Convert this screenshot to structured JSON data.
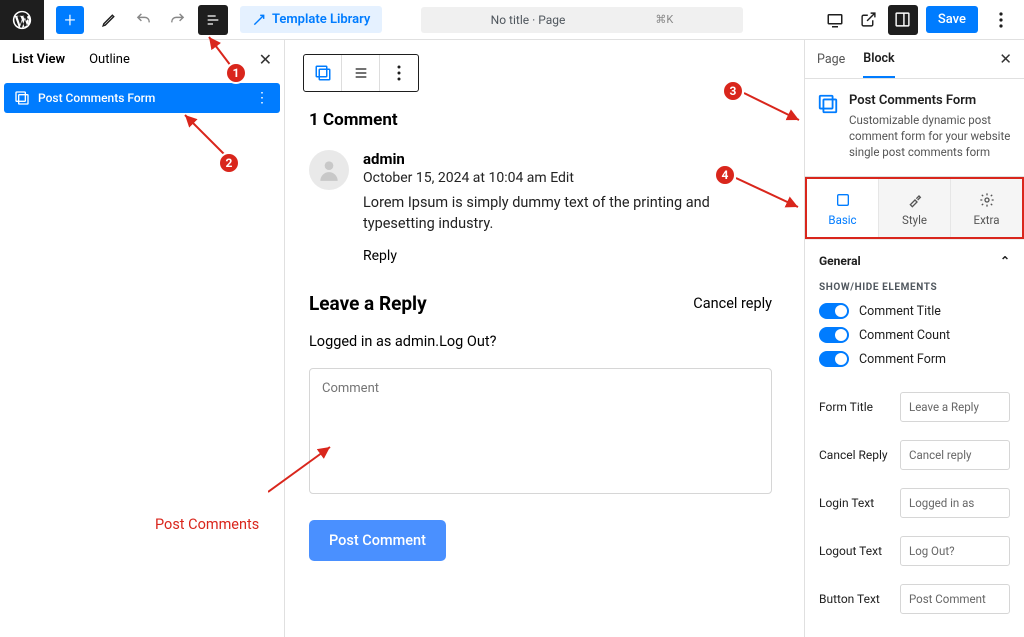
{
  "topbar": {
    "template_library": "Template Library",
    "title": "No title · Page",
    "shortcut": "⌘K",
    "save": "Save"
  },
  "left_panel": {
    "tabs": {
      "list_view": "List View",
      "outline": "Outline"
    },
    "item": {
      "label": "Post Comments Form"
    }
  },
  "canvas": {
    "comment_count": "1 Comment",
    "author": "admin",
    "date": "October 15, 2024 at 10:04 am",
    "edit": "Edit",
    "body": "Lorem Ipsum is simply dummy text of the printing and typesetting industry.",
    "reply": "Reply",
    "leave_reply": "Leave a Reply",
    "cancel_reply": "Cancel reply",
    "logged_in_prefix": "Logged in as admin.",
    "logout": "Log Out?",
    "placeholder": "Comment",
    "submit": "Post Comment"
  },
  "right_panel": {
    "tabs": {
      "page": "Page",
      "block": "Block"
    },
    "block_name": "Post Comments Form",
    "block_desc": "Customizable dynamic post comment form for your website single post comments form",
    "tri": {
      "basic": "Basic",
      "style": "Style",
      "extra": "Extra"
    },
    "general": "General",
    "show_hide": "SHOW/HIDE ELEMENTS",
    "toggles": {
      "title": "Comment Title",
      "count": "Comment Count",
      "form": "Comment Form"
    },
    "fields": {
      "form_title": {
        "label": "Form Title",
        "value": "Leave a Reply"
      },
      "cancel_reply": {
        "label": "Cancel Reply",
        "value": "Cancel reply"
      },
      "login_text": {
        "label": "Login Text",
        "value": "Logged in as"
      },
      "logout_text": {
        "label": "Logout Text",
        "value": "Log Out?"
      },
      "button_text": {
        "label": "Button Text",
        "value": "Post Comment"
      }
    }
  },
  "annotations": {
    "n1": "1",
    "n2": "2",
    "n3": "3",
    "n4": "4",
    "post_comments_label": "Post Comments"
  }
}
